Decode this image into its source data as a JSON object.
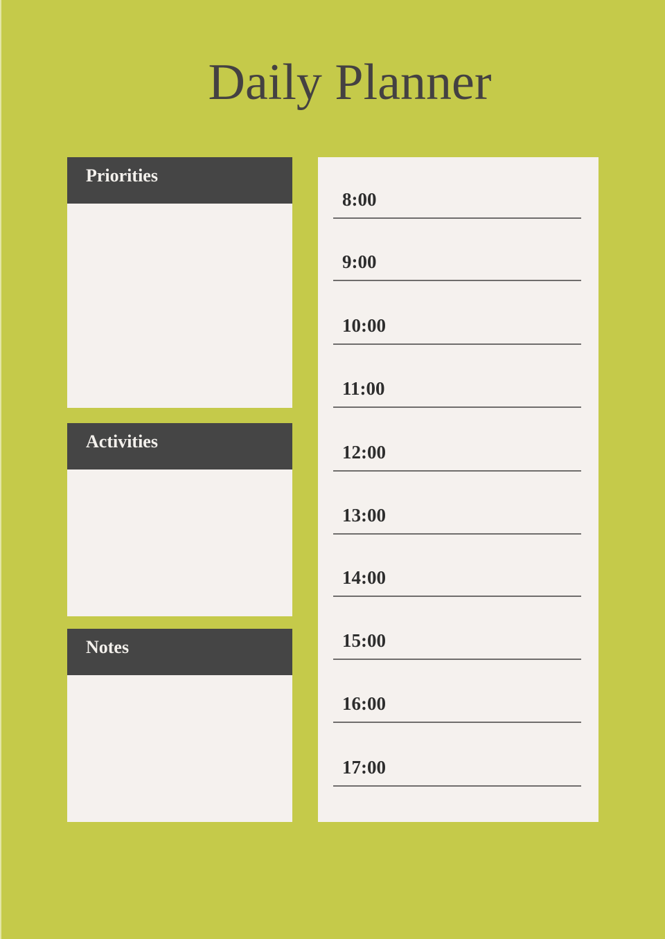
{
  "title": "Daily Planner",
  "colors": {
    "background": "#c5ca4a",
    "panel": "#f5f1ee",
    "header": "#454545",
    "header_text": "#f3f0ec",
    "title_text": "#444142"
  },
  "sections": {
    "priorities": {
      "label": "Priorities"
    },
    "activities": {
      "label": "Activities"
    },
    "notes": {
      "label": "Notes"
    }
  },
  "schedule": {
    "times": [
      "8:00",
      "9:00",
      "10:00",
      "11:00",
      "12:00",
      "13:00",
      "14:00",
      "15:00",
      "16:00",
      "17:00"
    ]
  }
}
